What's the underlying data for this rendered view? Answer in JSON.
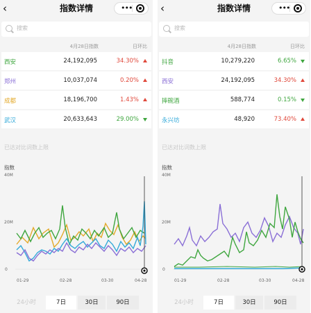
{
  "screens": [
    {
      "nav": {
        "back": "‹",
        "title": "指数详情"
      },
      "search": {
        "placeholder": "搜索"
      },
      "table": {
        "col_value": "4月28日指数",
        "col_change": "日环比",
        "rows": [
          {
            "name": "西安",
            "value": "24,192,095",
            "change": "34.30%",
            "dir": "up",
            "color": "#3fa63f"
          },
          {
            "name": "郑州",
            "value": "10,037,074",
            "change": "0.20%",
            "dir": "up",
            "color": "#8a6fd6"
          },
          {
            "name": "成都",
            "value": "18,196,700",
            "change": "1.43%",
            "dir": "up",
            "color": "#e3a92a"
          },
          {
            "name": "武汉",
            "value": "20,633,643",
            "change": "29.00%",
            "dir": "down",
            "color": "#32a9d9"
          }
        ]
      },
      "note": "已达对比词数上限",
      "chart": {
        "ylabel": "指数",
        "ticks": [
          "40M",
          "20M",
          "0"
        ],
        "xticks": [
          "01-29",
          "02-28",
          "03-30",
          "04-28"
        ]
      },
      "tabs": [
        "24小时",
        "7日",
        "30日",
        "90日"
      ]
    },
    {
      "nav": {
        "back": "‹",
        "title": "指数详情"
      },
      "search": {
        "placeholder": "搜索"
      },
      "table": {
        "col_value": "4月28日指数",
        "col_change": "日环比",
        "rows": [
          {
            "name": "抖音",
            "value": "10,279,220",
            "change": "6.65%",
            "dir": "down",
            "color": "#3fa63f"
          },
          {
            "name": "西安",
            "value": "24,192,095",
            "change": "34.30%",
            "dir": "up",
            "color": "#8a6fd6"
          },
          {
            "name": "摔碗酒",
            "value": "588,774",
            "change": "0.15%",
            "dir": "down",
            "color": "#3fa63f"
          },
          {
            "name": "永兴坊",
            "value": "48,920",
            "change": "73.40%",
            "dir": "up",
            "color": "#32a9d9"
          }
        ]
      },
      "note": "已达对比词数上限",
      "chart": {
        "ylabel": "指数",
        "ticks": [
          "40M",
          "20M",
          "0"
        ],
        "xticks": [
          "01-29",
          "02-28",
          "03-30",
          "04-28"
        ]
      },
      "tabs": [
        "24小时",
        "7日",
        "30日",
        "90日"
      ]
    }
  ],
  "colors": {
    "up": "#e0483b",
    "down": "#3fa63f",
    "green": "#3fa63f",
    "purple": "#8a6fd6",
    "yellow": "#e3a92a",
    "blue": "#32a9d9"
  }
}
